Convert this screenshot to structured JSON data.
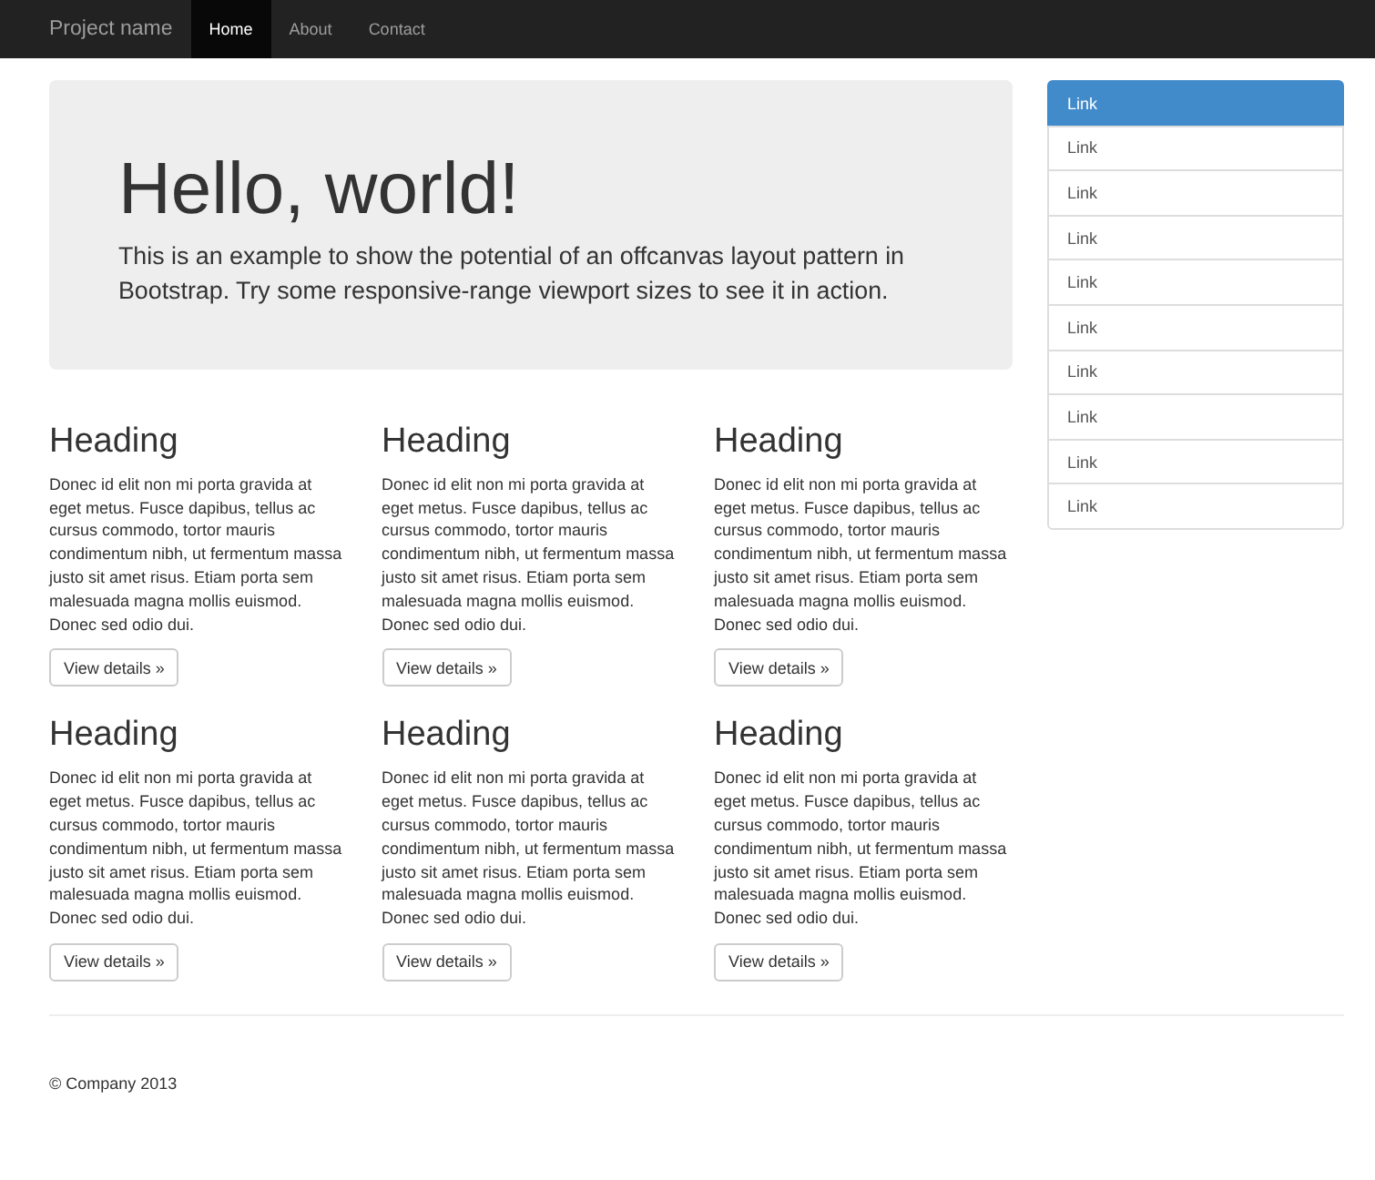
{
  "navbar": {
    "brand": "Project name",
    "items": [
      {
        "label": "Home",
        "selected": true
      },
      {
        "label": "About",
        "selected": false
      },
      {
        "label": "Contact",
        "selected": false
      }
    ]
  },
  "jumbotron": {
    "title": "Hello, world!",
    "text": "This is an example to show the potential of an offcanvas layout pattern in Bootstrap. Try some responsive-range viewport sizes to see it in action."
  },
  "cards": [
    {
      "heading": "Heading",
      "text": "Donec id elit non mi porta gravida at eget metus. Fusce dapibus, tellus ac cursus commodo, tortor mauris condimentum nibh, ut fermentum massa justo sit amet risus. Etiam porta sem malesuada magna mollis euismod. Donec sed odio dui.",
      "button": "View details »"
    },
    {
      "heading": "Heading",
      "text": "Donec id elit non mi porta gravida at eget metus. Fusce dapibus, tellus ac cursus commodo, tortor mauris condimentum nibh, ut fermentum massa justo sit amet risus. Etiam porta sem malesuada magna mollis euismod. Donec sed odio dui.",
      "button": "View details »"
    },
    {
      "heading": "Heading",
      "text": "Donec id elit non mi porta gravida at eget metus. Fusce dapibus, tellus ac cursus commodo, tortor mauris condimentum nibh, ut fermentum massa justo sit amet risus. Etiam porta sem malesuada magna mollis euismod. Donec sed odio dui.",
      "button": "View details »"
    },
    {
      "heading": "Heading",
      "text": "Donec id elit non mi porta gravida at eget metus. Fusce dapibus, tellus ac cursus commodo, tortor mauris condimentum nibh, ut fermentum massa justo sit amet risus. Etiam porta sem malesuada magna mollis euismod. Donec sed odio dui.",
      "button": "View details »"
    },
    {
      "heading": "Heading",
      "text": "Donec id elit non mi porta gravida at eget metus. Fusce dapibus, tellus ac cursus commodo, tortor mauris condimentum nibh, ut fermentum massa justo sit amet risus. Etiam porta sem malesuada magna mollis euismod. Donec sed odio dui.",
      "button": "View details »"
    },
    {
      "heading": "Heading",
      "text": "Donec id elit non mi porta gravida at eget metus. Fusce dapibus, tellus ac cursus commodo, tortor mauris condimentum nibh, ut fermentum massa justo sit amet risus. Etiam porta sem malesuada magna mollis euismod. Donec sed odio dui.",
      "button": "View details »"
    }
  ],
  "sidebar": {
    "items": [
      {
        "label": "Link",
        "selected": true
      },
      {
        "label": "Link",
        "selected": false
      },
      {
        "label": "Link",
        "selected": false
      },
      {
        "label": "Link",
        "selected": false
      },
      {
        "label": "Link",
        "selected": false
      },
      {
        "label": "Link",
        "selected": false
      },
      {
        "label": "Link",
        "selected": false
      },
      {
        "label": "Link",
        "selected": false
      },
      {
        "label": "Link",
        "selected": false
      },
      {
        "label": "Link",
        "selected": false
      }
    ]
  },
  "footer": "© Company 2013"
}
